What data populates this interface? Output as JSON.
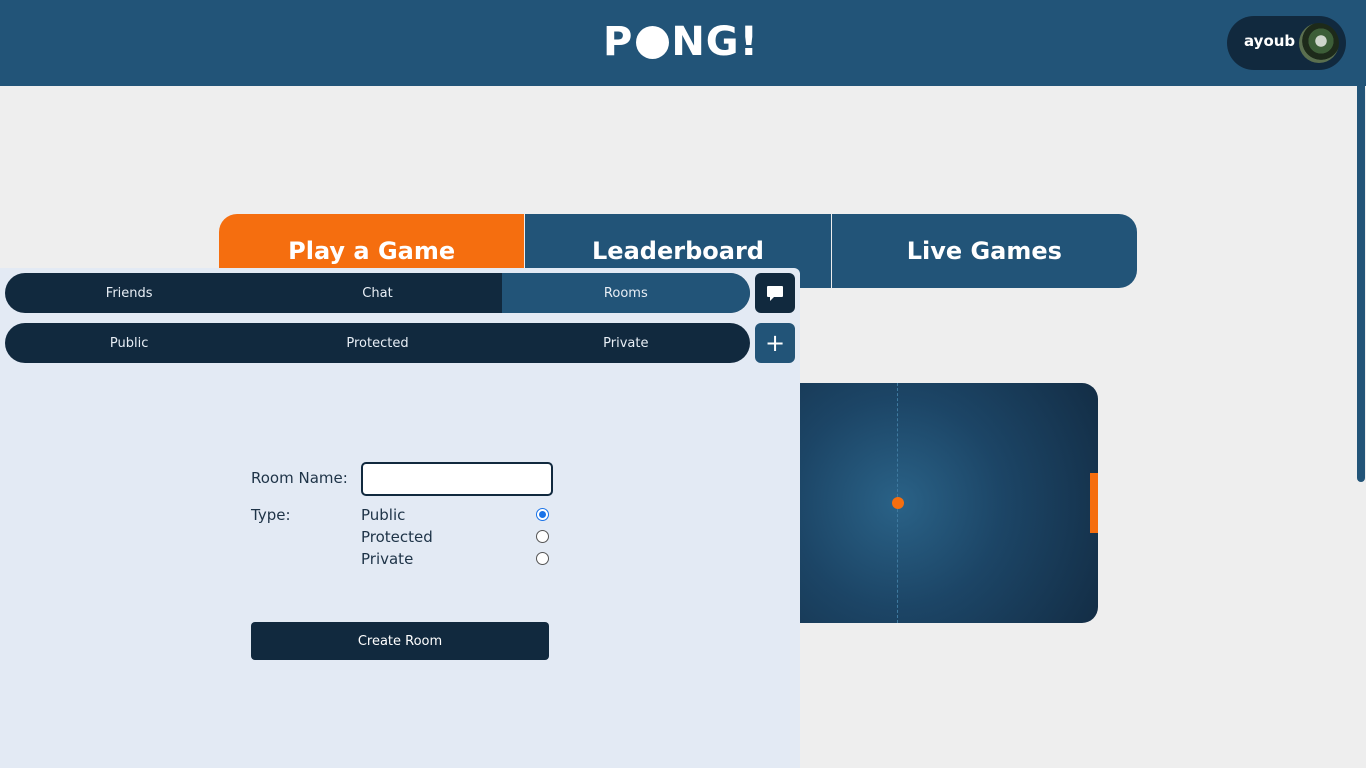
{
  "header": {
    "logo_text_left": "P",
    "logo_text_right": "NG!",
    "username": "ayoub"
  },
  "main_tabs": [
    {
      "label": "Play a Game",
      "active": true
    },
    {
      "label": "Leaderboard",
      "active": false
    },
    {
      "label": "Live Games",
      "active": false
    }
  ],
  "chat_panel": {
    "nav_tabs": [
      {
        "label": "Friends",
        "active": false
      },
      {
        "label": "Chat",
        "active": false
      },
      {
        "label": "Rooms",
        "active": true
      }
    ],
    "room_tabs": [
      {
        "label": "Public"
      },
      {
        "label": "Protected"
      },
      {
        "label": "Private"
      }
    ],
    "chat_button_icon": "message-icon",
    "add_button_label": "+",
    "form": {
      "room_name_label": "Room Name:",
      "room_name_value": "",
      "type_label": "Type:",
      "type_options": [
        {
          "label": "Public",
          "checked": true
        },
        {
          "label": "Protected",
          "checked": false
        },
        {
          "label": "Private",
          "checked": false
        }
      ],
      "submit_label": "Create Room"
    }
  },
  "colors": {
    "primary": "#225478",
    "dark": "#11293e",
    "accent": "#f56e0f",
    "panel_bg": "#e3eaf4",
    "page_bg": "#eeeeee"
  }
}
